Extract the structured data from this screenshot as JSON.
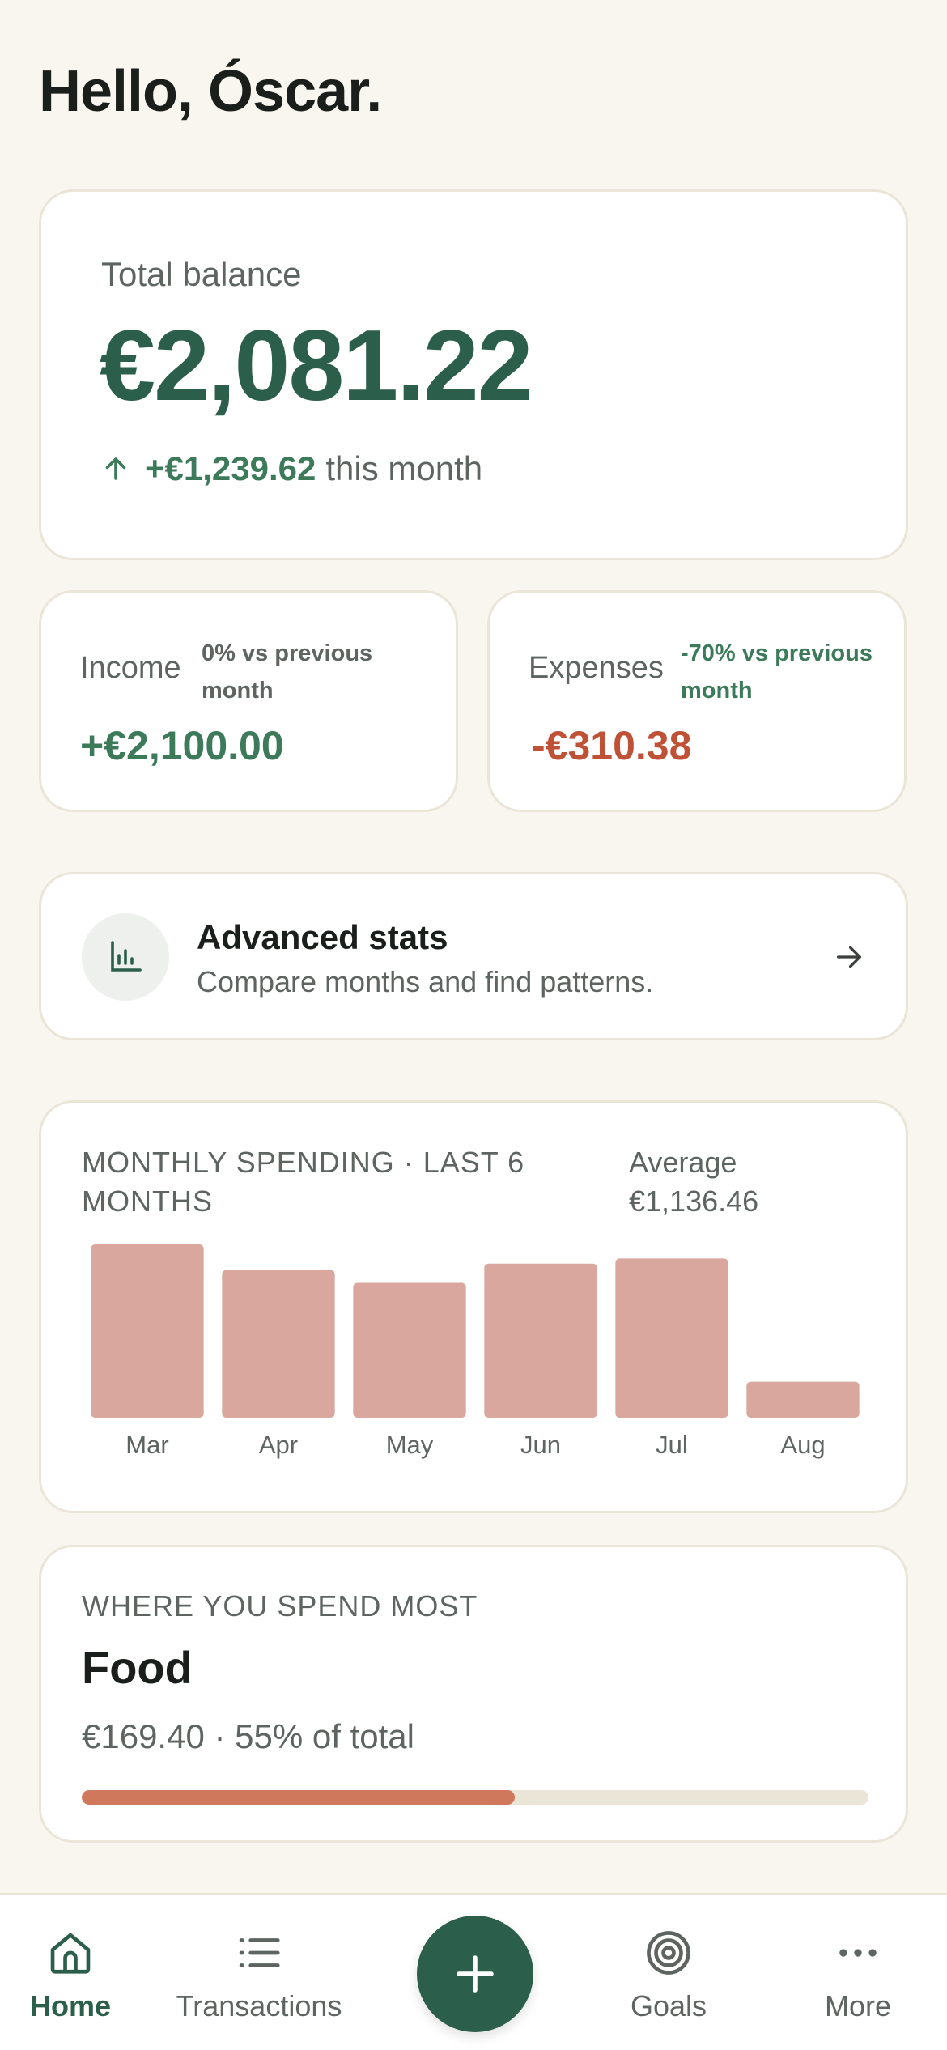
{
  "greeting": "Hello, Óscar.",
  "balance": {
    "label": "Total balance",
    "amount": "€2,081.22",
    "delta": "+€1,239.62",
    "delta_suffix": "this month"
  },
  "income": {
    "label": "Income",
    "compare": "0% vs previous month",
    "value": "+€2,100.00"
  },
  "expenses": {
    "label": "Expenses",
    "compare": "-70% vs previous month",
    "value": "-€310.38"
  },
  "advanced_stats": {
    "title": "Advanced stats",
    "subtitle": "Compare months and find patterns."
  },
  "monthly_spending": {
    "title": "MONTHLY SPENDING · LAST 6 MONTHS",
    "average_label": "Average",
    "average_value": "€1,136.46"
  },
  "chart_data": {
    "type": "bar",
    "categories": [
      "Mar",
      "Apr",
      "May",
      "Jun",
      "Jul",
      "Aug"
    ],
    "values": [
      1350,
      1150,
      1050,
      1200,
      1240,
      280
    ],
    "ylim": [
      0,
      1350
    ],
    "grid": false,
    "bar_color": "#d9a79d"
  },
  "where_spend": {
    "title": "WHERE YOU SPEND MOST",
    "category": "Food",
    "detail": "€169.40 · 55% of total",
    "share": 0.55
  },
  "nav": {
    "home": "Home",
    "transactions": "Transactions",
    "goals": "Goals",
    "more": "More"
  },
  "colors": {
    "accent": "#2b5e4b",
    "positive": "#3c7a5a",
    "negative": "#bf5136",
    "progress": "#cf785b",
    "background": "#f9f6f0"
  },
  "icons": {
    "balance_trend": "arrow-up-icon",
    "advanced_stats": "bar-chart-icon",
    "advanced_arrow": "arrow-right-icon",
    "home": "home-icon",
    "transactions": "list-icon",
    "add": "plus-icon",
    "goals": "target-icon",
    "more": "more-dots-icon"
  }
}
